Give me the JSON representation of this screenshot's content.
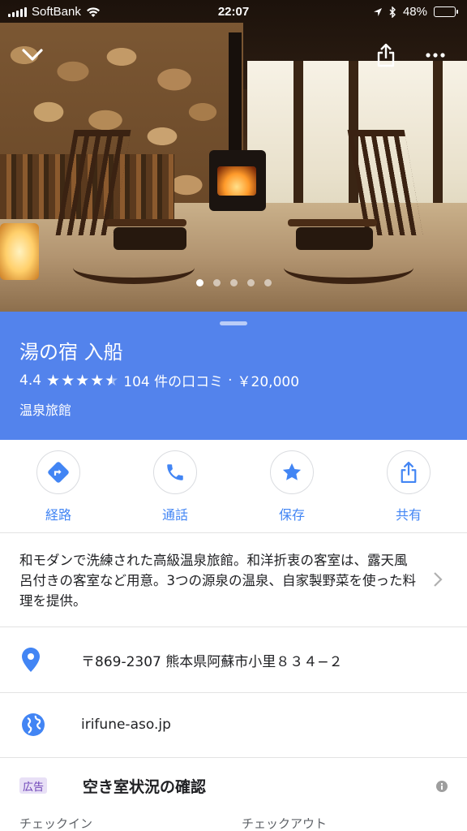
{
  "status_bar": {
    "carrier": "SoftBank",
    "time": "22:07",
    "battery": "48%",
    "battery_level": 0.48,
    "battery_color": "#ffd60a"
  },
  "hero": {
    "photo_count": 5,
    "active_index": 0,
    "icons": [
      "chevron-down-icon",
      "share-icon",
      "more-icon"
    ]
  },
  "place": {
    "name": "湯の宿 入船",
    "rating": "4.4",
    "rating_value": 4.4,
    "reviews": "104 件の口コミ",
    "separator": "·",
    "price": "￥20,000",
    "category": "温泉旅館",
    "header_color": "#5383ec"
  },
  "actions": [
    {
      "label": "経路",
      "icon": "directions-icon"
    },
    {
      "label": "通話",
      "icon": "phone-icon"
    },
    {
      "label": "保存",
      "icon": "star-icon"
    },
    {
      "label": "共有",
      "icon": "share-icon"
    }
  ],
  "accent_color": "#4285f4",
  "description": "和モダンで洗練された高級温泉旅館。和洋折衷の客室は、露天風呂付きの客室など用意。3つの源泉の温泉、自家製野菜を使った料理を提供。",
  "address": "〒869-2307 熊本県阿蘇市小里８３４−２",
  "website": "irifune-aso.jp",
  "availability": {
    "ad_badge": "広告",
    "title": "空き室状況の確認",
    "checkin_label": "チェックイン",
    "checkout_label": "チェックアウト"
  }
}
